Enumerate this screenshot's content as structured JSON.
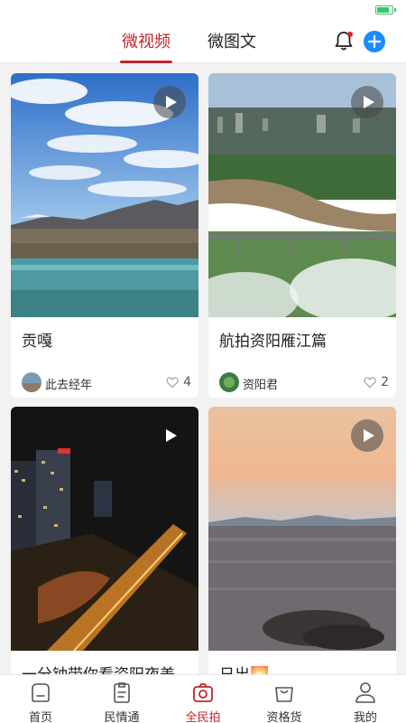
{
  "status": {
    "battery_level": 0.7,
    "battery_color": "#3cc66a"
  },
  "header": {
    "tabs": [
      {
        "label": "微视频",
        "active": true
      },
      {
        "label": "微图文",
        "active": false
      }
    ],
    "accent_color": "#c0272d",
    "icons": [
      "bell-icon",
      "add-icon"
    ]
  },
  "cards": [
    {
      "title": "贡嘎",
      "author": "此去经年",
      "likes": "4"
    },
    {
      "title": "航拍资阳雁江篇",
      "author": "资阳君",
      "likes": "2"
    },
    {
      "title": "一分钟带你看资阳夜美",
      "author": "",
      "likes": ""
    },
    {
      "title": "日出🌅",
      "author": "",
      "likes": ""
    }
  ],
  "bottom_nav": [
    {
      "label": "首页",
      "icon": "home-icon",
      "active": false
    },
    {
      "label": "民情通",
      "icon": "clipboard-icon",
      "active": false
    },
    {
      "label": "全民拍",
      "icon": "camera-icon",
      "active": true
    },
    {
      "label": "资格货",
      "icon": "shopping-bag-icon",
      "active": false
    },
    {
      "label": "我的",
      "icon": "user-icon",
      "active": false
    }
  ]
}
